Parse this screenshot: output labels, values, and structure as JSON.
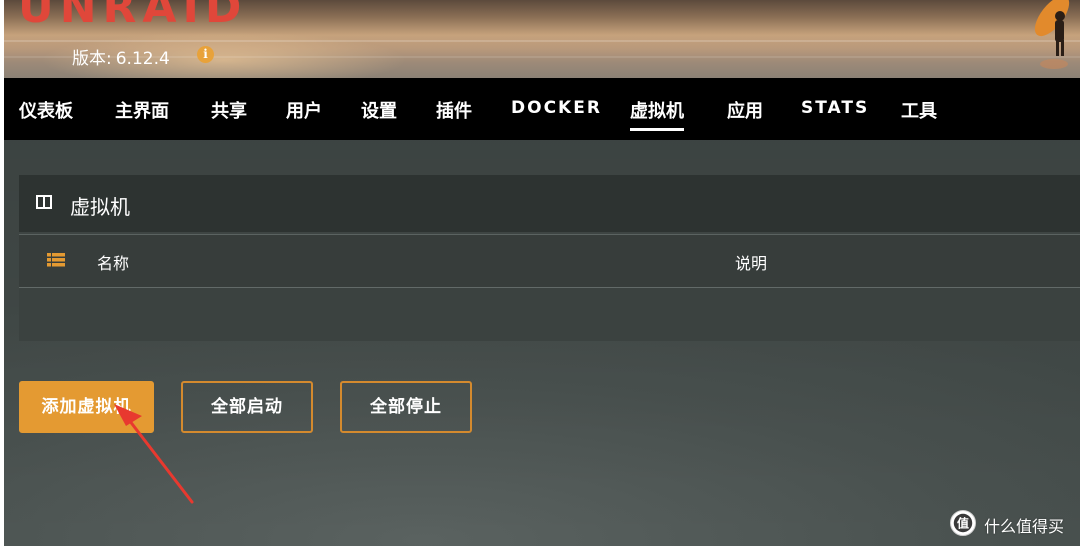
{
  "header": {
    "logo_text": "UNRAID",
    "version_label": "版本:",
    "version_number": "6.12.4",
    "info_icon": "info-icon",
    "accent_color": "#e0473a"
  },
  "nav": {
    "items": [
      {
        "label": "仪表板"
      },
      {
        "label": "主界面"
      },
      {
        "label": "共享"
      },
      {
        "label": "用户"
      },
      {
        "label": "设置"
      },
      {
        "label": "插件"
      },
      {
        "label": "DOCKER"
      },
      {
        "label": "虚拟机",
        "active": true
      },
      {
        "label": "应用"
      },
      {
        "label": "STATS"
      },
      {
        "label": "工具"
      }
    ]
  },
  "panel": {
    "title": "虚拟机",
    "icon": "columns-icon",
    "columns": {
      "name": "名称",
      "description": "说明"
    },
    "list_icon": "list-icon"
  },
  "buttons": {
    "add": "添加虚拟机",
    "start_all": "全部启动",
    "stop_all": "全部停止",
    "button_color": "#e49a32"
  },
  "watermark": {
    "text": "什么值得买",
    "icon": "smzdm-logo-icon"
  }
}
